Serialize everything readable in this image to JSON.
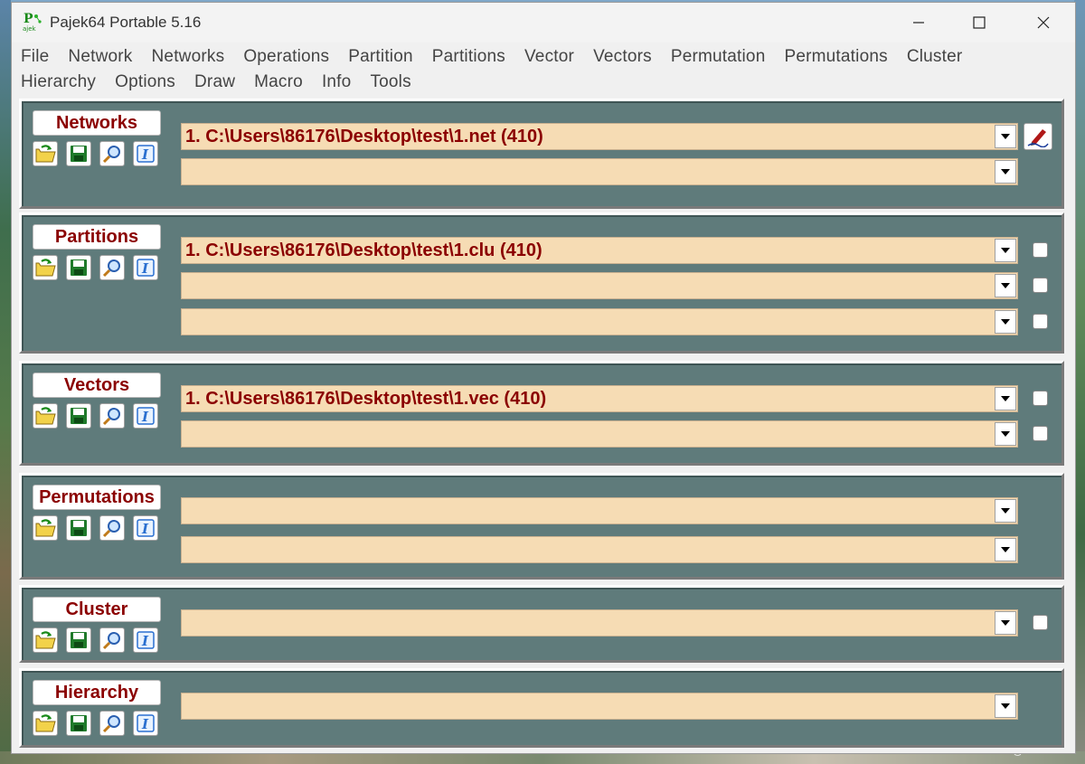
{
  "window": {
    "title": "Pajek64 Portable 5.16"
  },
  "menu": {
    "row1": [
      "File",
      "Network",
      "Networks",
      "Operations",
      "Partition",
      "Partitions",
      "Vector",
      "Vectors",
      "Permutation",
      "Permutations",
      "Cluster"
    ],
    "row2": [
      "Hierarchy",
      "Options",
      "Draw",
      "Macro",
      "Info",
      "Tools"
    ]
  },
  "panels": {
    "networks": {
      "label": "Networks",
      "combos": [
        "1. C:\\Users\\86176\\Desktop\\test\\1.net (410)",
        ""
      ]
    },
    "partitions": {
      "label": "Partitions",
      "combos": [
        "1. C:\\Users\\86176\\Desktop\\test\\1.clu (410)",
        "",
        ""
      ]
    },
    "vectors": {
      "label": "Vectors",
      "combos": [
        "1. C:\\Users\\86176\\Desktop\\test\\1.vec (410)",
        ""
      ]
    },
    "permutations": {
      "label": "Permutations",
      "combos": [
        "",
        ""
      ]
    },
    "cluster": {
      "label": "Cluster",
      "combos": [
        ""
      ]
    },
    "hierarchy": {
      "label": "Hierarchy",
      "combos": [
        ""
      ]
    }
  },
  "icons": {
    "open": "open-folder-icon",
    "save": "save-disk-icon",
    "view": "magnifier-icon",
    "info": "info-icon",
    "edit": "edit-pen-icon"
  },
  "watermark": "CSDN @dxw-1997",
  "colors": {
    "panel_bg": "#5f7b7b",
    "combo_bg": "#f6dcb4",
    "label_text": "#8b0000"
  }
}
